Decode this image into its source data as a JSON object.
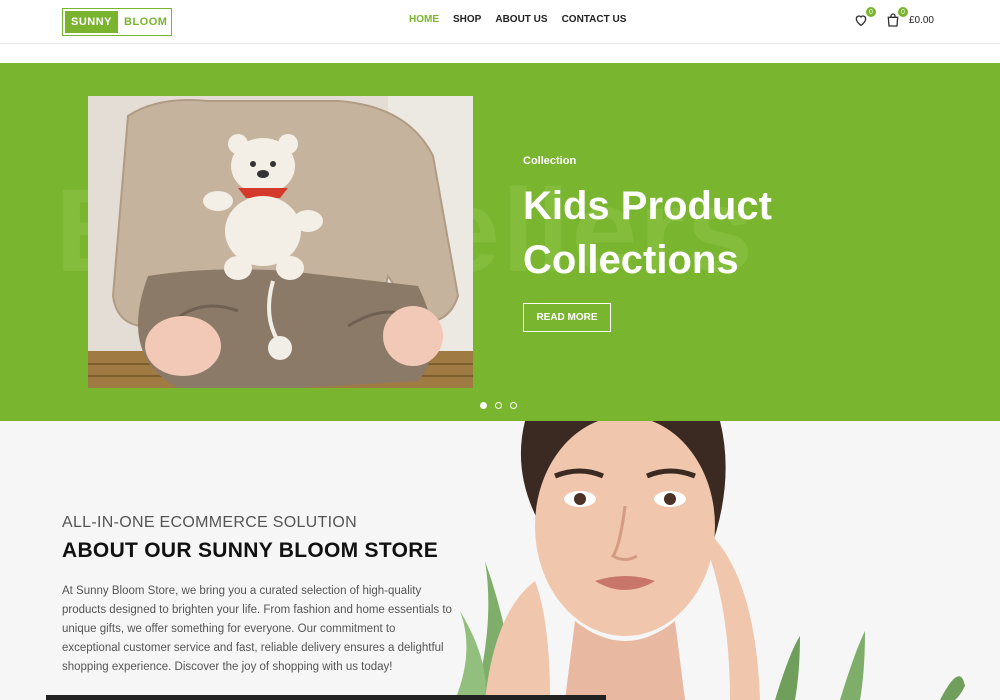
{
  "header": {
    "logo_left": "SUNNY",
    "logo_right": "BLOOM",
    "nav": [
      {
        "label": "HOME",
        "active": true
      },
      {
        "label": "SHOP",
        "active": false
      },
      {
        "label": "ABOUT US",
        "active": false
      },
      {
        "label": "CONTACT US",
        "active": false
      }
    ],
    "wishlist_count": "0",
    "cart_count": "0",
    "cart_total": "£0.00"
  },
  "hero": {
    "bg_text": "Best Sellers",
    "collection_label": "Collection",
    "title_line1": "Kids Product",
    "title_line2": "Collections",
    "button_label": "READ MORE",
    "slides": 3,
    "active_slide": 1
  },
  "about": {
    "subtitle": "ALL-IN-ONE ECOMMERCE SOLUTION",
    "title": "ABOUT OUR SUNNY BLOOM STORE",
    "body": "At Sunny Bloom Store, we bring you a curated selection of high-quality products designed to brighten your life. From fashion and home essentials to unique gifts, we offer something for everyone. Our commitment to exceptional customer service and fast, reliable delivery ensures a delightful shopping experience. Discover the joy of shopping with us today!"
  },
  "icons": {
    "wishlist": "heart-icon",
    "cart": "shopping-bag-icon"
  },
  "colors": {
    "brand_green": "#79b52f",
    "text_dark": "#111111"
  }
}
